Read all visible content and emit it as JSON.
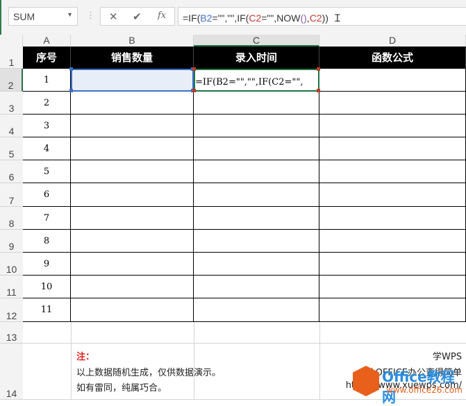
{
  "formula_bar": {
    "name_box": "SUM",
    "cancel": "✕",
    "confirm": "✔",
    "fx": "fx",
    "formula_parts": [
      "=IF(",
      "B2",
      "=\"\",\"\",IF(",
      "C2",
      "=\"\",NOW",
      "()",
      ",",
      "C2",
      "))"
    ]
  },
  "columns": [
    "A",
    "B",
    "C",
    "D"
  ],
  "row_numbers": [
    "1",
    "2",
    "3",
    "4",
    "5",
    "6",
    "7",
    "8",
    "9",
    "10",
    "11",
    "12",
    "13",
    "14"
  ],
  "headers": [
    "序号",
    "销售数量",
    "录入时间",
    "函数公式"
  ],
  "serials": [
    "1",
    "2",
    "3",
    "4",
    "5",
    "6",
    "7",
    "8",
    "9",
    "10",
    "11"
  ],
  "editing_cell_text": "=IF(B2=\"\",\"\",IF(C2=\"\",",
  "note": {
    "title": "注：",
    "line1": "以上数据随机生成，仅供数据演示。",
    "line2": "如有雷同，纯属巧合。"
  },
  "right_note": {
    "line1": "学WPS",
    "line2": "让OFFICE办公变得简单",
    "line3": "https://www.xuewps.com/"
  },
  "watermark": {
    "brand": "Office教程网",
    "url": "www.office26.com"
  },
  "colors": {
    "header_bg": "#000000",
    "selection_blue": "#3b6fc4",
    "active_green": "#217346",
    "note_red": "#e02020"
  }
}
